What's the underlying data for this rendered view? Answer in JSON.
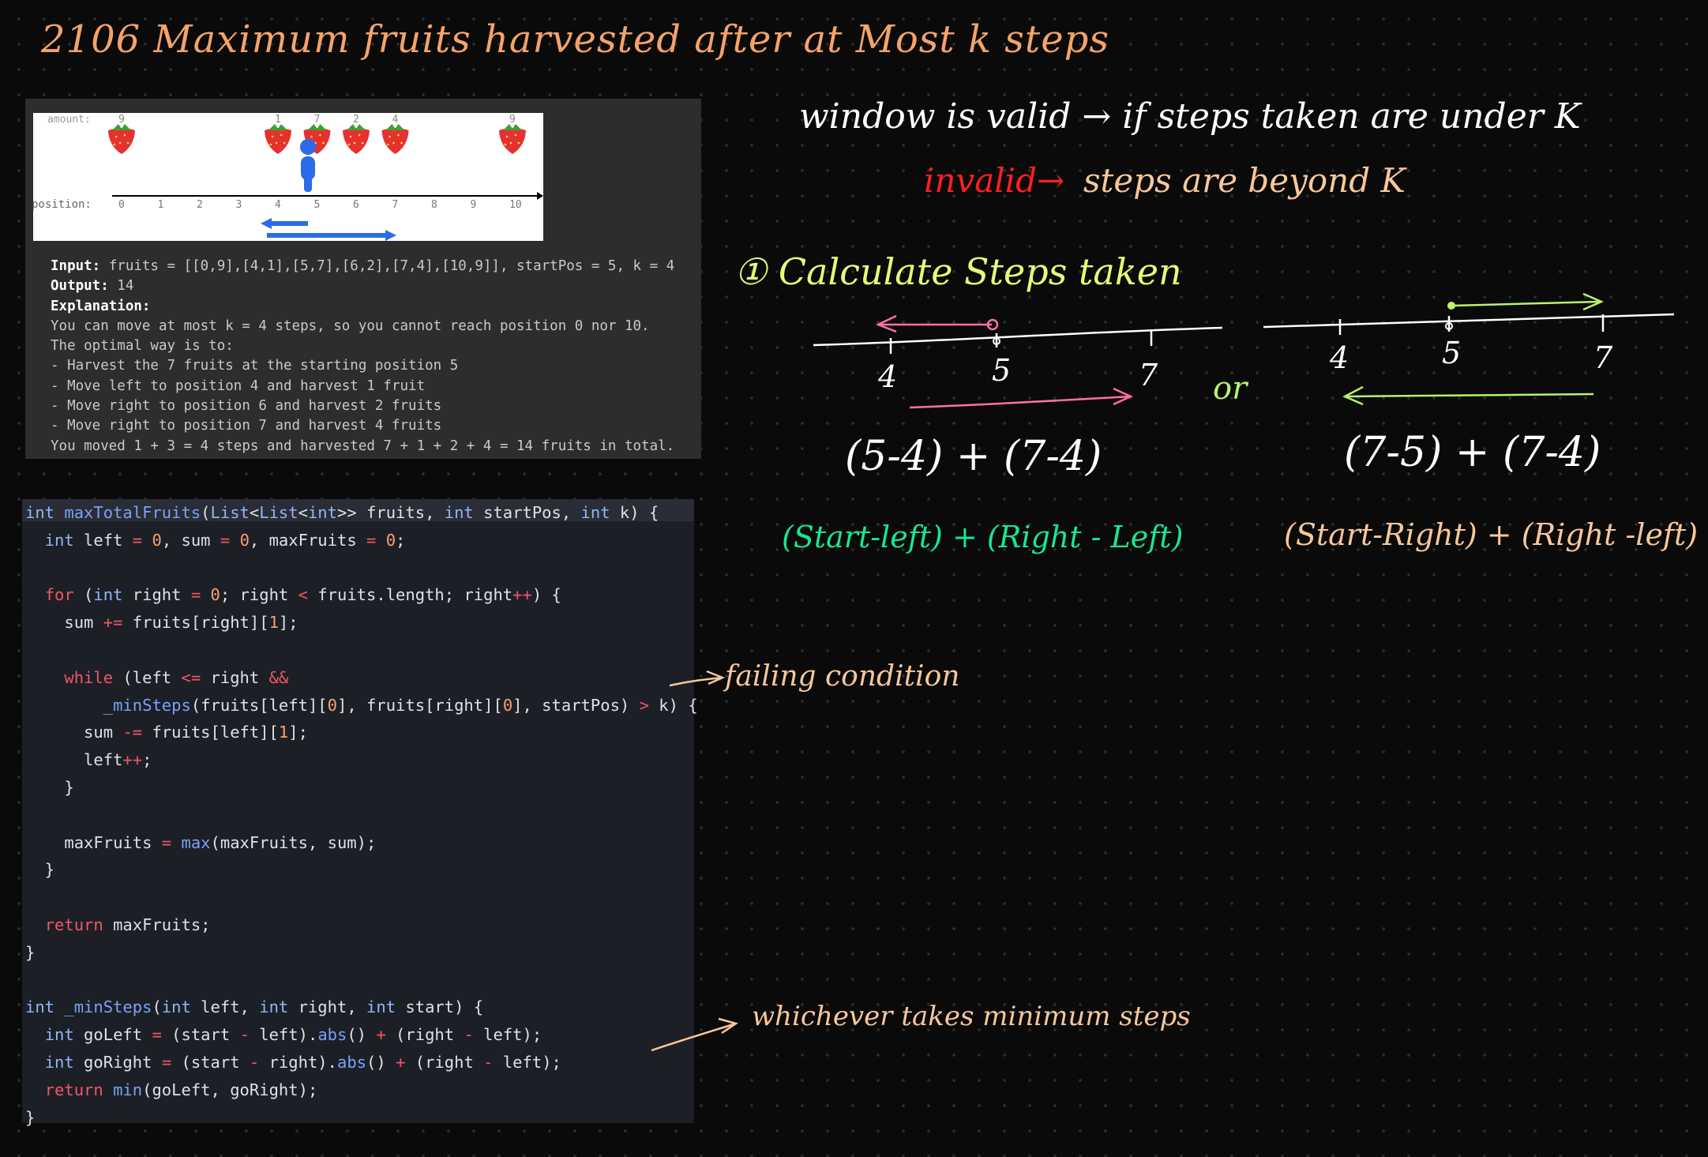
{
  "title": "2106  Maximum fruits harvested after at Most k steps",
  "example": {
    "image": {
      "amount_label": "amount:",
      "position_label": "position:",
      "amounts": [
        {
          "pos": 0,
          "value": "9"
        },
        {
          "pos": 4,
          "value": "1"
        },
        {
          "pos": 5,
          "value": "7"
        },
        {
          "pos": 6,
          "value": "2"
        },
        {
          "pos": 7,
          "value": "4"
        },
        {
          "pos": 10,
          "value": "9"
        }
      ],
      "positions": [
        "0",
        "1",
        "2",
        "3",
        "4",
        "5",
        "6",
        "7",
        "8",
        "9",
        "10"
      ]
    },
    "input_label": "Input:",
    "input_value": " fruits = [[0,9],[4,1],[5,7],[6,2],[7,4],[10,9]], startPos = 5, k = 4",
    "output_label": "Output:",
    "output_value": " 14",
    "explanation_label": "Explanation:",
    "explanation_lines": [
      "You can move at most k = 4 steps, so you cannot reach position 0 nor 10.",
      "The optimal way is to:",
      "- Harvest the 7 fruits at the starting position 5",
      "- Move left to position 4 and harvest 1 fruit",
      "- Move right to position 6 and harvest 2 fruits",
      "- Move right to position 7 and harvest 4 fruits",
      "You moved 1 + 3 = 4 steps and harvested 7 + 1 + 2 + 4 = 14 fruits in total."
    ]
  },
  "notes": {
    "window_valid": "window is valid → if steps taken are under K",
    "invalid_word": "invalid→",
    "invalid_rest": "steps are beyond K",
    "step_one": "① Calculate Steps taken",
    "left_ticks": [
      "4",
      "5",
      "7"
    ],
    "right_ticks": [
      "4",
      "5",
      "7"
    ],
    "or": "or",
    "left_expr": "(5-4) + (7-4)",
    "right_expr": "(7-5) + (7-4)",
    "left_formula": "(Start-left) + (Right - Left)",
    "right_formula": "(Start-Right) + (Right -left)",
    "failing": "failing condition",
    "whichever": "whichever takes minimum steps"
  },
  "colors": {
    "title": "#f4a36a",
    "white_ink": "#ffffff",
    "red_ink": "#ff1f1f",
    "orange_ink": "#f8c79a",
    "yellow_green_ink": "#e5ff75",
    "green_ink": "#17e88f",
    "pink_ink": "#ff6fa8",
    "lime_ink": "#b8f36a"
  }
}
